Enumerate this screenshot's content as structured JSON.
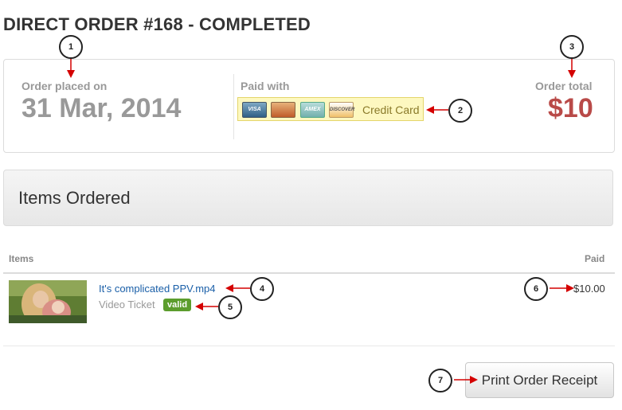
{
  "page": {
    "title": "DIRECT ORDER #168 - COMPLETED"
  },
  "summary": {
    "placed_label": "Order placed on",
    "placed_date": "31 Mar, 2014",
    "paid_label": "Paid with",
    "payment_method": "Credit Card",
    "cards": [
      "VISA",
      "MasterCard",
      "AMEX",
      "DISCOVER"
    ],
    "total_label": "Order total",
    "total_value": "$10"
  },
  "items_panel": {
    "title": "Items Ordered"
  },
  "table": {
    "headers": [
      "Items",
      "Paid"
    ],
    "rows": [
      {
        "name": "It's complicated PPV.mp4",
        "type": "Video Ticket",
        "status": "valid",
        "price": "$10.00"
      }
    ]
  },
  "actions": {
    "print_label": "Print Order Receipt"
  },
  "annotations": [
    "1",
    "2",
    "3",
    "4",
    "5",
    "6",
    "7"
  ],
  "colors": {
    "total": "#b94a48",
    "link": "#1a5fa8",
    "valid": "#5c9d2d",
    "arrow": "#d40000"
  }
}
